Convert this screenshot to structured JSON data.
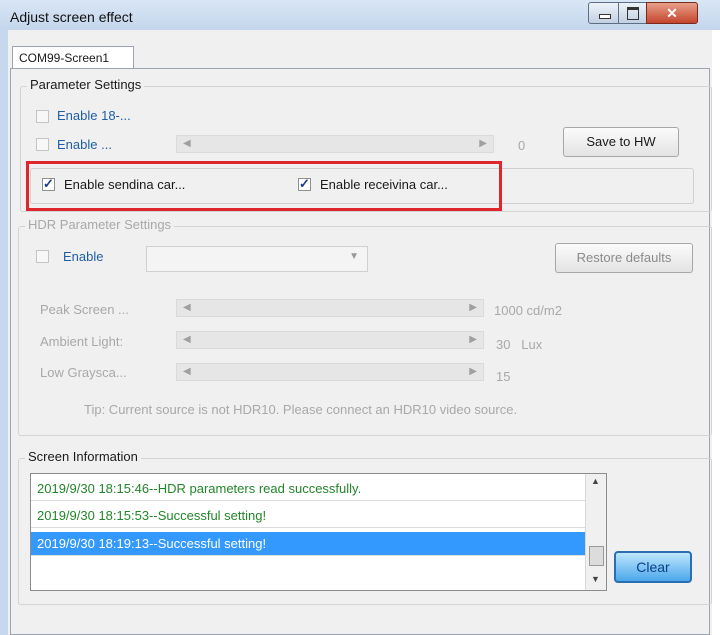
{
  "window": {
    "title": "Adjust screen effect"
  },
  "tab": {
    "label": "COM99-Screen1"
  },
  "parameter_settings": {
    "title": "Parameter Settings",
    "enable18_label": "Enable 18-...",
    "enable_slider_label": "Enable ...",
    "slider_value": "0",
    "save_label": "Save to HW",
    "sending_label": "Enable sendina car...",
    "receiving_label": "Enable receivina car..."
  },
  "hdr": {
    "title": "HDR Parameter Settings",
    "enable_label": "Enable",
    "restore_label": "Restore defaults",
    "rows": [
      {
        "label": "Peak Screen ...",
        "value": "1000 cd/m2"
      },
      {
        "label": "Ambient Light:",
        "value": "30   Lux"
      },
      {
        "label": "Low Graysca...",
        "value": "15"
      }
    ],
    "tip": "Tip: Current source is not HDR10. Please connect an HDR10 video source."
  },
  "screen_info": {
    "title": "Screen Information",
    "items": [
      "2019/9/30 18:15:46--HDR parameters read successfully.",
      "2019/9/30 18:15:53--Successful setting!",
      "2019/9/30 18:19:13--Successful setting!"
    ],
    "clear_label": "Clear"
  }
}
